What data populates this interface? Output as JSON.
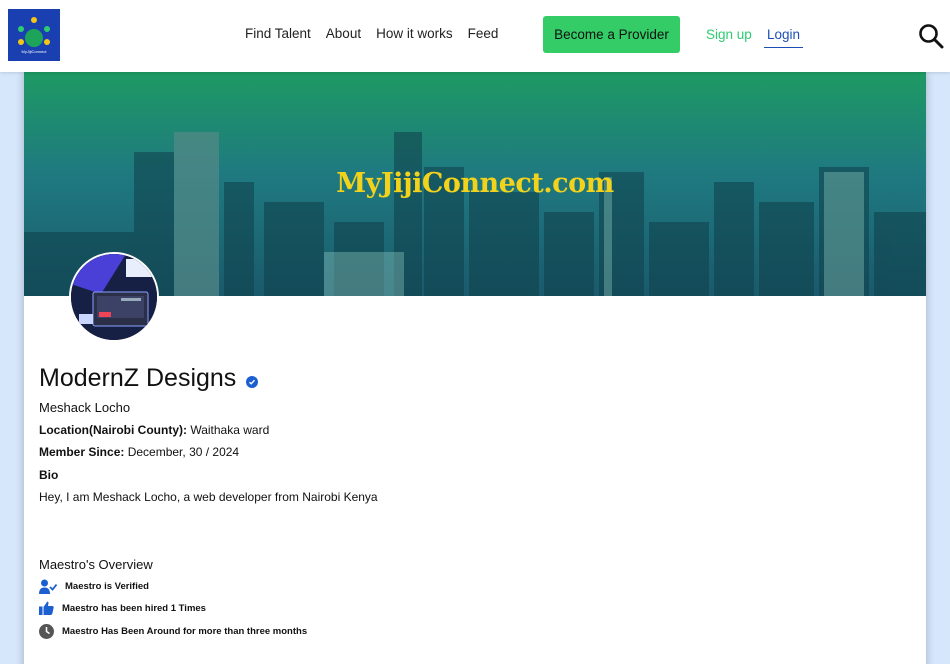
{
  "brand": {
    "logo_text": "MyJijiConnect"
  },
  "nav": {
    "items": [
      "Find Talent",
      "About",
      "How it works",
      "Feed"
    ]
  },
  "header": {
    "provider_button": "Become a Provider",
    "signup": "Sign up",
    "login": "Login"
  },
  "banner": {
    "title": "MyJijiConnect.com"
  },
  "profile": {
    "business_name": "ModernZ Designs",
    "owner": "Meshack Locho",
    "location_label": "Location(Nairobi County):",
    "location_value": "Waithaka ward",
    "member_label": "Member Since:",
    "member_value": "December, 30 / 2024",
    "bio_label": "Bio",
    "bio_text": "Hey, I am Meshack Locho, a web developer from Nairobi Kenya"
  },
  "overview": {
    "title": "Maestro's Overview",
    "items": [
      "Maestro is Verified",
      "Maestro has been hired 1 Times",
      "Maestro Has Been Around for more than three months"
    ]
  },
  "colors": {
    "accent_green": "#33cc66",
    "link_blue": "#1b4fb5",
    "banner_title": "#f2d21b"
  }
}
